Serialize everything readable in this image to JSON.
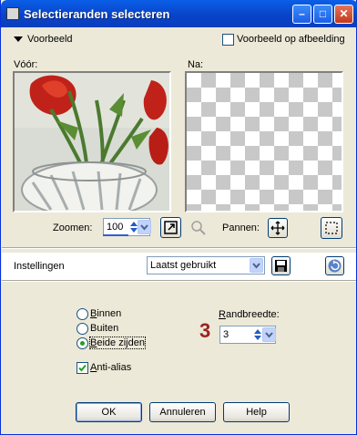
{
  "window": {
    "title": "Selectieranden selecteren",
    "controls": {
      "minimize": "–",
      "maximize": "□",
      "close": "✕"
    }
  },
  "preview": {
    "header_label": "Voorbeeld",
    "preview_on_image": "Voorbeeld op afbeelding",
    "before_label": "Vóór:",
    "after_label": "Na:",
    "zoom_label": "Zoomen:",
    "zoom_value": "100",
    "pan_label": "Pannen:"
  },
  "settings": {
    "label": "Instellingen",
    "preset": "Laatst gebruikt"
  },
  "options": {
    "radios": [
      {
        "label": "Binnen",
        "checked": false
      },
      {
        "label": "Buiten",
        "checked": false
      },
      {
        "label": "Beide zijden",
        "checked": true
      }
    ],
    "border_width_label": "Randbreedte:",
    "border_width_value": "3",
    "annotation": "3",
    "antialias_label": "Anti-alias",
    "antialias_checked": true
  },
  "buttons": {
    "ok": "OK",
    "cancel": "Annuleren",
    "help": "Help"
  },
  "colors": {
    "titlebar": "#0842c6",
    "face": "#ece9d8",
    "accent": "#21a121",
    "annotation": "#9c2222"
  }
}
